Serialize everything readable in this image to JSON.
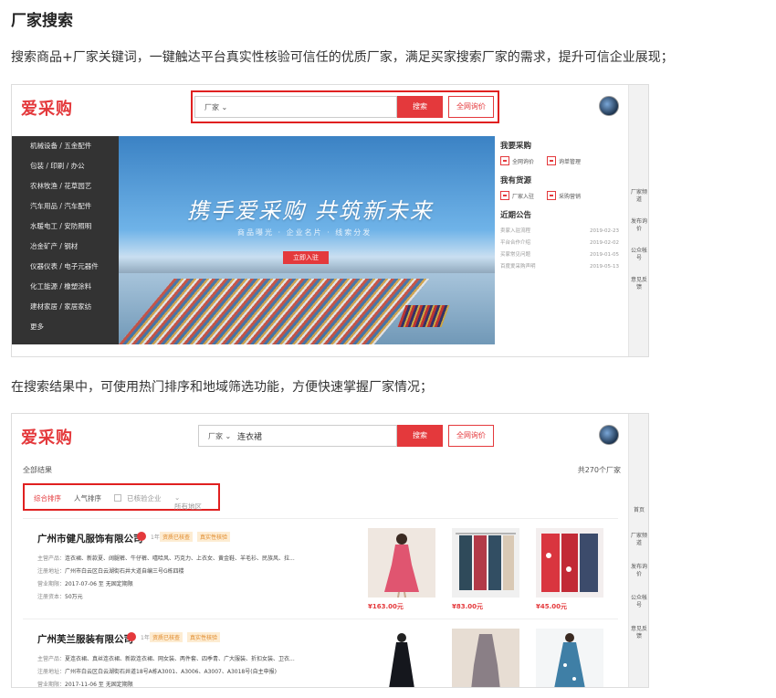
{
  "article": {
    "heading": "厂家搜索",
    "para1": "搜索商品+厂家关键词，一键触达平台真实性核验可信任的优质厂家，满足买家搜索厂家的需求，提升可信企业展现；",
    "para2": "在搜索结果中，可使用热门排序和地域筛选功能，方便快速掌握厂家情况；"
  },
  "brand": {
    "logo": "爱采购",
    "accent": "#e4393c",
    "highlight": "#e02020"
  },
  "screenshot1": {
    "search": {
      "category": "厂家",
      "keyword": "",
      "search_btn": "搜索",
      "price_btn": "全网询价"
    },
    "left_nav": [
      "机械设备 / 五金配件",
      "包装 / 印刷 / 办公",
      "农林牧渔 / 花草园艺",
      "汽车用品 / 汽车配件",
      "水暖电工 / 安防照明",
      "冶金矿产 / 钢材",
      "仪器仪表 / 电子元器件",
      "化工能源 / 橡塑涂料",
      "建材家居 / 家居家纺",
      "更多"
    ],
    "banner": {
      "slogan": "携手爱采购 共筑新未来",
      "subtitle": "商品曝光 · 企业名片 · 线索分发",
      "cta": "立即入驻"
    },
    "panel": {
      "buy_title": "我要采购",
      "buy_items": [
        "全网询价",
        "询单管理"
      ],
      "supply_title": "我有货源",
      "supply_items": [
        "厂家入驻",
        "采购营销"
      ],
      "notice_title": "近期公告",
      "notices": [
        {
          "title": "卖家入驻流程",
          "date": "2019-02-23"
        },
        {
          "title": "平台合作介绍",
          "date": "2019-02-02"
        },
        {
          "title": "买家常见问题",
          "date": "2019-01-05"
        },
        {
          "title": "百度爱采购声明",
          "date": "2019-05-13"
        }
      ]
    },
    "side": [
      "厂家频道",
      "发布询价",
      "公众帐号",
      "意见反馈"
    ]
  },
  "screenshot2": {
    "search": {
      "category": "厂家",
      "keyword": "连衣裙",
      "search_btn": "搜索",
      "price_btn": "全网询价"
    },
    "all_results": "全部结果",
    "count": "共270个厂家",
    "filters": {
      "sort_default": "综合排序",
      "sort_popular": "人气排序",
      "verified": "已核验企业",
      "region": "所有地区"
    },
    "side": [
      "首页",
      "厂家频道",
      "发布询价",
      "公众帐号",
      "意见反馈"
    ],
    "companies": [
      {
        "name": "广州市健凡服饰有限公司",
        "year": "1年",
        "tag1": "资质已核查",
        "tag2": "真实性核验",
        "products_label": "主营产品：",
        "products": "连衣裙、新款夏、阔腿裤、牛仔裤、嘻哈风、巧克力、上衣女、黄金鞋、羊毛衫、民族风、拉...",
        "addr_label": "注册地址：",
        "addr": "广州市白云区白云湖街石井大道自编三号G栋四楼",
        "term_label": "营业期限：",
        "term": "2017-07-06 至 无固定期限",
        "cap_label": "注册资本：",
        "cap": "50万元",
        "prices": [
          "¥163.00元",
          "¥83.00元",
          "¥45.00元"
        ]
      },
      {
        "name": "广州芙兰服装有限公司",
        "year": "1年",
        "tag1": "资质已核查",
        "tag2": "真实性核验",
        "products_label": "主营产品：",
        "products": "夏连衣裙、真丝连衣裙、新款连衣裙、网女装、两件套、四季青、广大服装、折扣女装、卫衣...",
        "addr_label": "注册地址：",
        "addr": "广州市白云区白云湖街石井道18号A栋A3001、A3006、A3007、A3018号(自主申报)",
        "term_label": "营业期限：",
        "term": "2017-11-06 至 无固定期限"
      }
    ]
  }
}
